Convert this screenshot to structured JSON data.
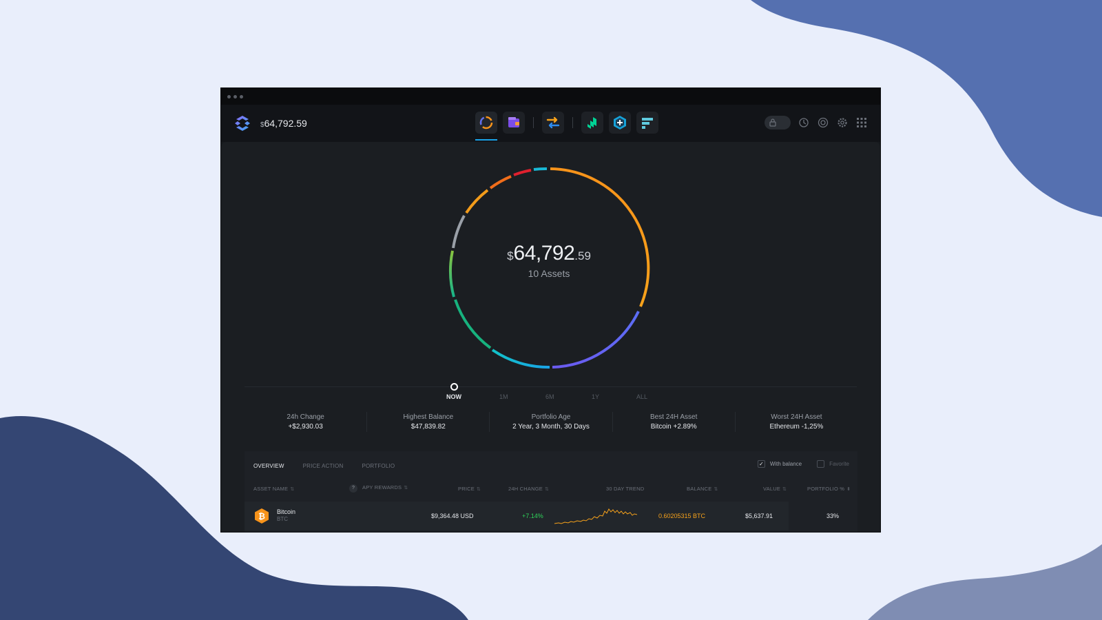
{
  "header": {
    "currency_symbol": "$",
    "portfolio_total": "64,792.59"
  },
  "nav_apps": [
    {
      "icon": "portfolio-icon"
    },
    {
      "icon": "wallet-icon"
    },
    {
      "icon": "exchange-icon"
    },
    {
      "icon": "compound-app-icon"
    },
    {
      "icon": "add-app-icon"
    },
    {
      "icon": "ftx-app-icon"
    }
  ],
  "toolbar_icons": [
    "lock-toggle",
    "history-icon",
    "help-icon",
    "settings-icon",
    "apps-grid-icon"
  ],
  "overview": {
    "currency_symbol": "$",
    "whole": "64,792",
    "cents": ".59",
    "assets_label": "10 Assets"
  },
  "timeline": {
    "labels": [
      "NOW",
      "1M",
      "6M",
      "1Y",
      "ALL"
    ],
    "selected": "NOW"
  },
  "stats": [
    {
      "label": "24h Change",
      "value": "+$2,930.03"
    },
    {
      "label": "Highest Balance",
      "value": "$47,839.82"
    },
    {
      "label": "Portfolio Age",
      "value": "2 Year, 3 Month, 30 Days"
    },
    {
      "label": "Best 24H Asset",
      "value": "Bitcoin +2.89%"
    },
    {
      "label": "Worst 24H Asset",
      "value": "Ethereum -1,25%"
    }
  ],
  "tabs": [
    "OVERVIEW",
    "PRICE ACTION",
    "PORTFOLIO"
  ],
  "filters": {
    "with_balance": {
      "label": "With balance",
      "checked": true
    },
    "favorite": {
      "label": "Favorite",
      "checked": false
    }
  },
  "columns": {
    "asset_name": "ASSET NAME",
    "apy_rewards": "APY REWARDS",
    "price": "PRICE",
    "change_24h": "24H CHANGE",
    "trend_30d": "30 DAY TREND",
    "balance": "BALANCE",
    "value": "VALUE",
    "portfolio_pct": "PORTFOLIO %"
  },
  "rows": [
    {
      "name": "Bitcoin",
      "ticker": "BTC",
      "price": "$9,364.48 USD",
      "change_24h": "+7.14%",
      "balance": "0.60205315 BTC",
      "value": "$5,637.91",
      "portfolio_pct": "33%"
    }
  ],
  "colors": {
    "accent": "#1aa3e8",
    "bitcoin": "#f7931a",
    "positive": "#2fd25a",
    "balance": "#f7a21b"
  }
}
